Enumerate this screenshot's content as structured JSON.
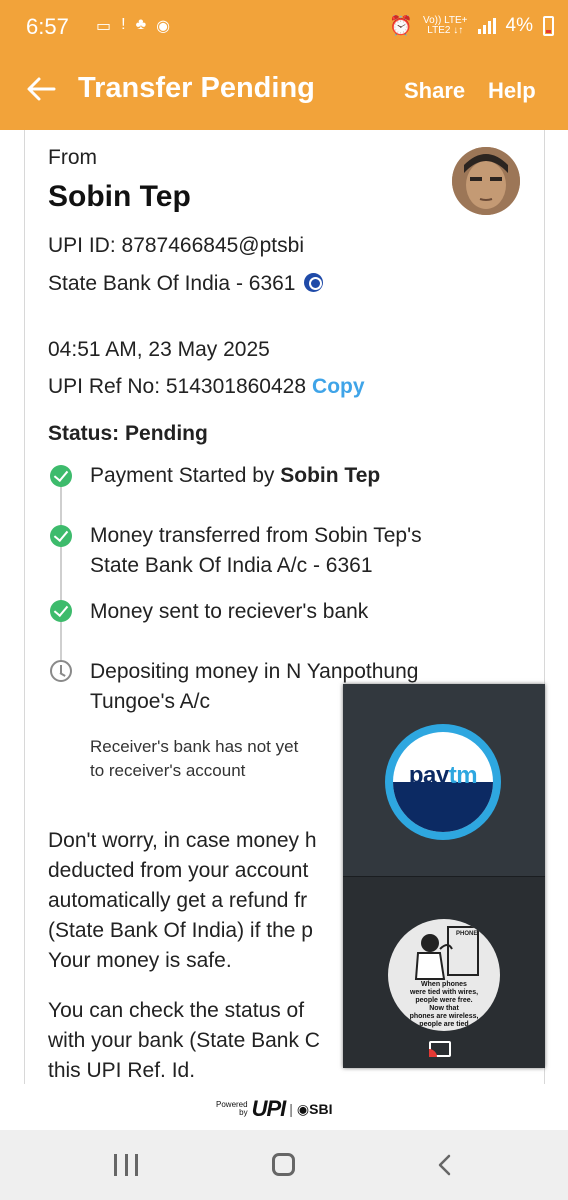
{
  "status_bar": {
    "time": "6:57",
    "network": "Vo)) LTE+\nLTE2 ↓↑",
    "battery": "4%"
  },
  "app_bar": {
    "title": "Transfer Pending",
    "share": "Share",
    "help": "Help"
  },
  "sender": {
    "from_label": "From",
    "name": "Sobin Tep",
    "upi_id": "UPI ID: 8787466845@ptsbi",
    "bank": "State Bank Of India - 6361"
  },
  "transaction": {
    "datetime": "04:51 AM, 23 May 2025",
    "ref_label": "UPI Ref No: 514301860428",
    "copy": "Copy",
    "status": "Status: Pending"
  },
  "steps": [
    {
      "text": "Payment Started by ",
      "bold": "Sobin Tep",
      "state": "done"
    },
    {
      "line1": "Money transferred from Sobin Tep's",
      "line2": "State Bank Of India A/c - 6361",
      "state": "done"
    },
    {
      "text": "Money sent to reciever's bank",
      "state": "done"
    },
    {
      "line1": "Depositing money in N Yanpothung",
      "line2": "Tungoe's A/c",
      "state": "pending",
      "note1": "Receiver's bank has not yet",
      "note2": "to receiver's account"
    }
  ],
  "info_paragraphs": {
    "p1": [
      "Don't worry, in case money h",
      "deducted from your account",
      "automatically get a refund fr",
      "(State Bank Of India) if the p",
      "Your money is safe."
    ],
    "p2": [
      "You can check the status of",
      "with your bank (State Bank C",
      "this UPI Ref. Id."
    ]
  },
  "footer": {
    "powered": "Powered",
    "by": "by",
    "upi": "UPI",
    "sbi": "SBI"
  },
  "pip": {
    "paytm": "pay",
    "paytm_tm": "tm",
    "poster_lines": [
      "PHONE",
      "When phones",
      "were tied with wires,",
      "people were free.",
      "Now that",
      "phones are wireless,",
      "people are tied"
    ]
  },
  "colors": {
    "accent": "#F2A33A",
    "success": "#3DBB6C",
    "link": "#3FA4E8"
  },
  "icons": [
    "back-arrow-icon",
    "info-icon",
    "check-circle-icon",
    "clock-icon",
    "cast-icon",
    "recents-icon",
    "home-icon",
    "back-icon"
  ]
}
